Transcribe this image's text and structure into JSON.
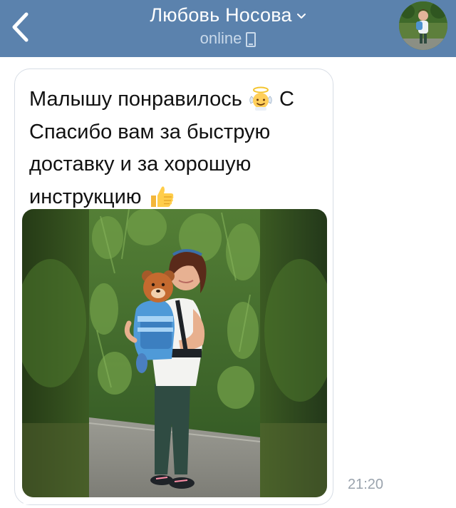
{
  "header": {
    "back_icon": "chevron-left-icon",
    "contact_name": "Любовь Носова",
    "dropdown_icon": "chevron-down-icon",
    "status": "online",
    "status_icon": "mobile-phone-icon",
    "avatar_icon": "contact-avatar"
  },
  "colors": {
    "header_bg": "#5b82ad",
    "header_text": "#ffffff",
    "status_text": "#c9d9ea",
    "bubble_border": "#d7dde5",
    "message_text": "#111111",
    "time_text": "#9aa3ad"
  },
  "message": {
    "lines": [
      {
        "before": "Малышу понравилось",
        "emoji": "angel-emoji",
        "after": "С"
      },
      {
        "text": "Спасибо вам за быструю"
      },
      {
        "text": "доставку и за хорошую"
      },
      {
        "before": "инструкцию",
        "emoji": "thumbs-up-emoji",
        "after": ""
      }
    ],
    "photo_icon": "attached-photo",
    "time": "21:20"
  }
}
